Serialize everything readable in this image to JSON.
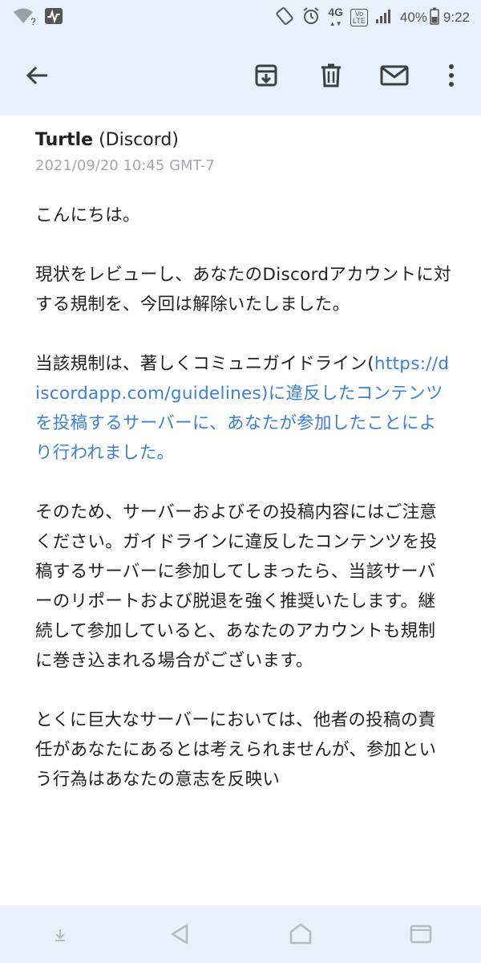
{
  "status_bar": {
    "sim_indicator": "?",
    "network": "4G",
    "volte_top": "Vo",
    "volte_bottom": "LTE",
    "battery": "40%",
    "time": "9:22",
    "icons": [
      "wifi-off-icon",
      "activity-icon",
      "rotate-icon",
      "alarm-icon",
      "signal-icon",
      "battery-icon"
    ]
  },
  "toolbar": {
    "icons": [
      "back-arrow-icon",
      "archive-icon",
      "delete-icon",
      "mail-icon",
      "more-vert-icon"
    ]
  },
  "email": {
    "sender_name": "Turtle",
    "sender_detail": " (Discord)",
    "date": "2021/09/20 10:45 GMT-7",
    "greeting": "こんにちは。",
    "para1": "現状をレビューし、あなたのDiscordアカウントに対する規制を、今回は解除いたしました。",
    "para2_prefix": "当該規制は、著しくコミュニガイドライン(",
    "para2_link": "https://discordapp.com/guidelines)に違反したコンテンツを投稿するサーバーに、あなたが参加したことにより行われました。",
    "para3": "そのため、サーバーおよびその投稿内容にはご注意ください。ガイドラインに違反したコンテンツを投稿するサーバーに参加してしまったら、当該サーバーのリポートおよび脱退を強く推奨いたします。継続して参加していると、あなたのアカウントも規制に巻き込まれる場合がございます。",
    "para4": "とくに巨大なサーバーにおいては、他者の投稿の責任があなたにあるとは考えられませんが、参加という行為はあなたの意志を反映い"
  },
  "nav_bar": {
    "icons": [
      "download-icon",
      "back-icon",
      "home-icon",
      "recents-icon"
    ]
  },
  "colors": {
    "bar_background": "#e8f0fb",
    "link": "#3c7fd4",
    "text": "#202124",
    "muted": "#a4a8ae"
  }
}
